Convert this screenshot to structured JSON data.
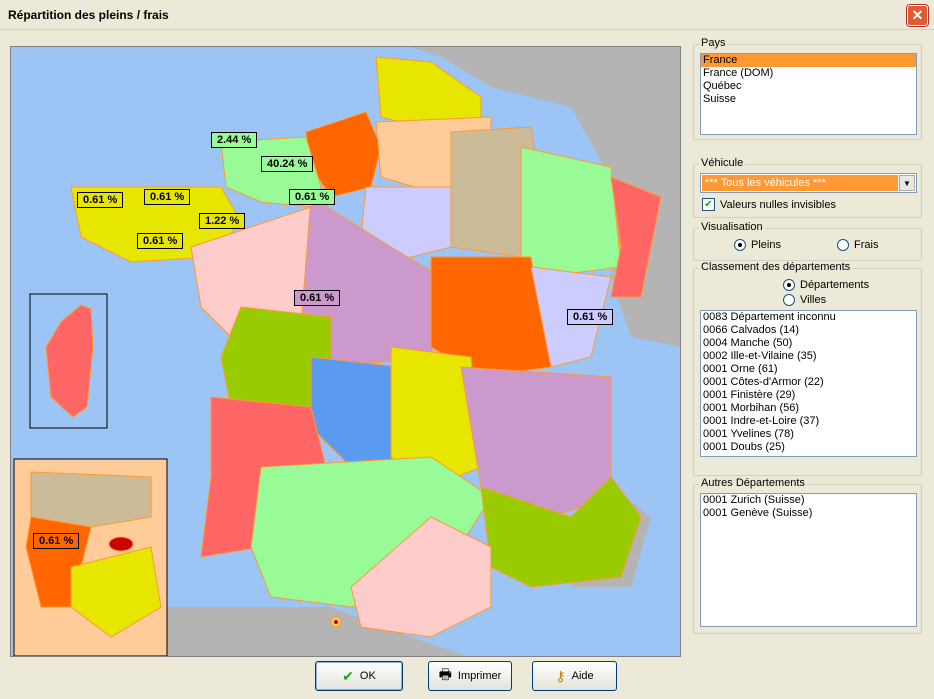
{
  "window": {
    "title": "Répartition des pleins / frais",
    "close_glyph": "✕"
  },
  "map": {
    "labels": [
      "2.44 %",
      "40.24 %",
      "0.61 %",
      "0.61 %",
      "0.61 %",
      "1.22 %",
      "0.61 %",
      "0.61 %",
      "0.61 %",
      "0.61 %"
    ],
    "colors": {
      "sea": "#9cc5f5",
      "land_gray": "#b4b4b4",
      "border_orange": "#ff9933"
    }
  },
  "pays": {
    "title": "Pays",
    "items": [
      "France",
      "France (DOM)",
      "Québec",
      "Suisse"
    ],
    "selected": "France"
  },
  "vehicule": {
    "title": "Véhicule",
    "selected": "*** Tous les véhicules ***",
    "null_invisible_label": "Valeurs nulles invisibles",
    "null_invisible_checked": true
  },
  "visualisation": {
    "title": "Visualisation",
    "options": [
      "Pleins",
      "Frais"
    ],
    "selected": "Pleins"
  },
  "classement": {
    "title": "Classement des départements",
    "options": [
      "Départements",
      "Villes"
    ],
    "selected": "Départements",
    "items": [
      "0083 Département inconnu",
      "0066 Calvados (14)",
      "0004 Manche (50)",
      "0002 Ille-et-Vilaine (35)",
      "0001 Orne (61)",
      "0001 Côtes-d'Armor (22)",
      "0001 Finistère (29)",
      "0001 Morbihan (56)",
      "0001 Indre-et-Loire (37)",
      "0001 Yvelines (78)",
      "0001 Doubs (25)"
    ]
  },
  "autres": {
    "title": "Autres Départements",
    "items": [
      "0001 Zurich (Suisse)",
      "0001 Genève (Suisse)"
    ]
  },
  "buttons": {
    "ok": {
      "label": "OK",
      "icon": "check-icon"
    },
    "print": {
      "label": "Imprimer",
      "icon": "printer-icon"
    },
    "help": {
      "label": "Aide",
      "icon": "help-key-icon"
    }
  }
}
